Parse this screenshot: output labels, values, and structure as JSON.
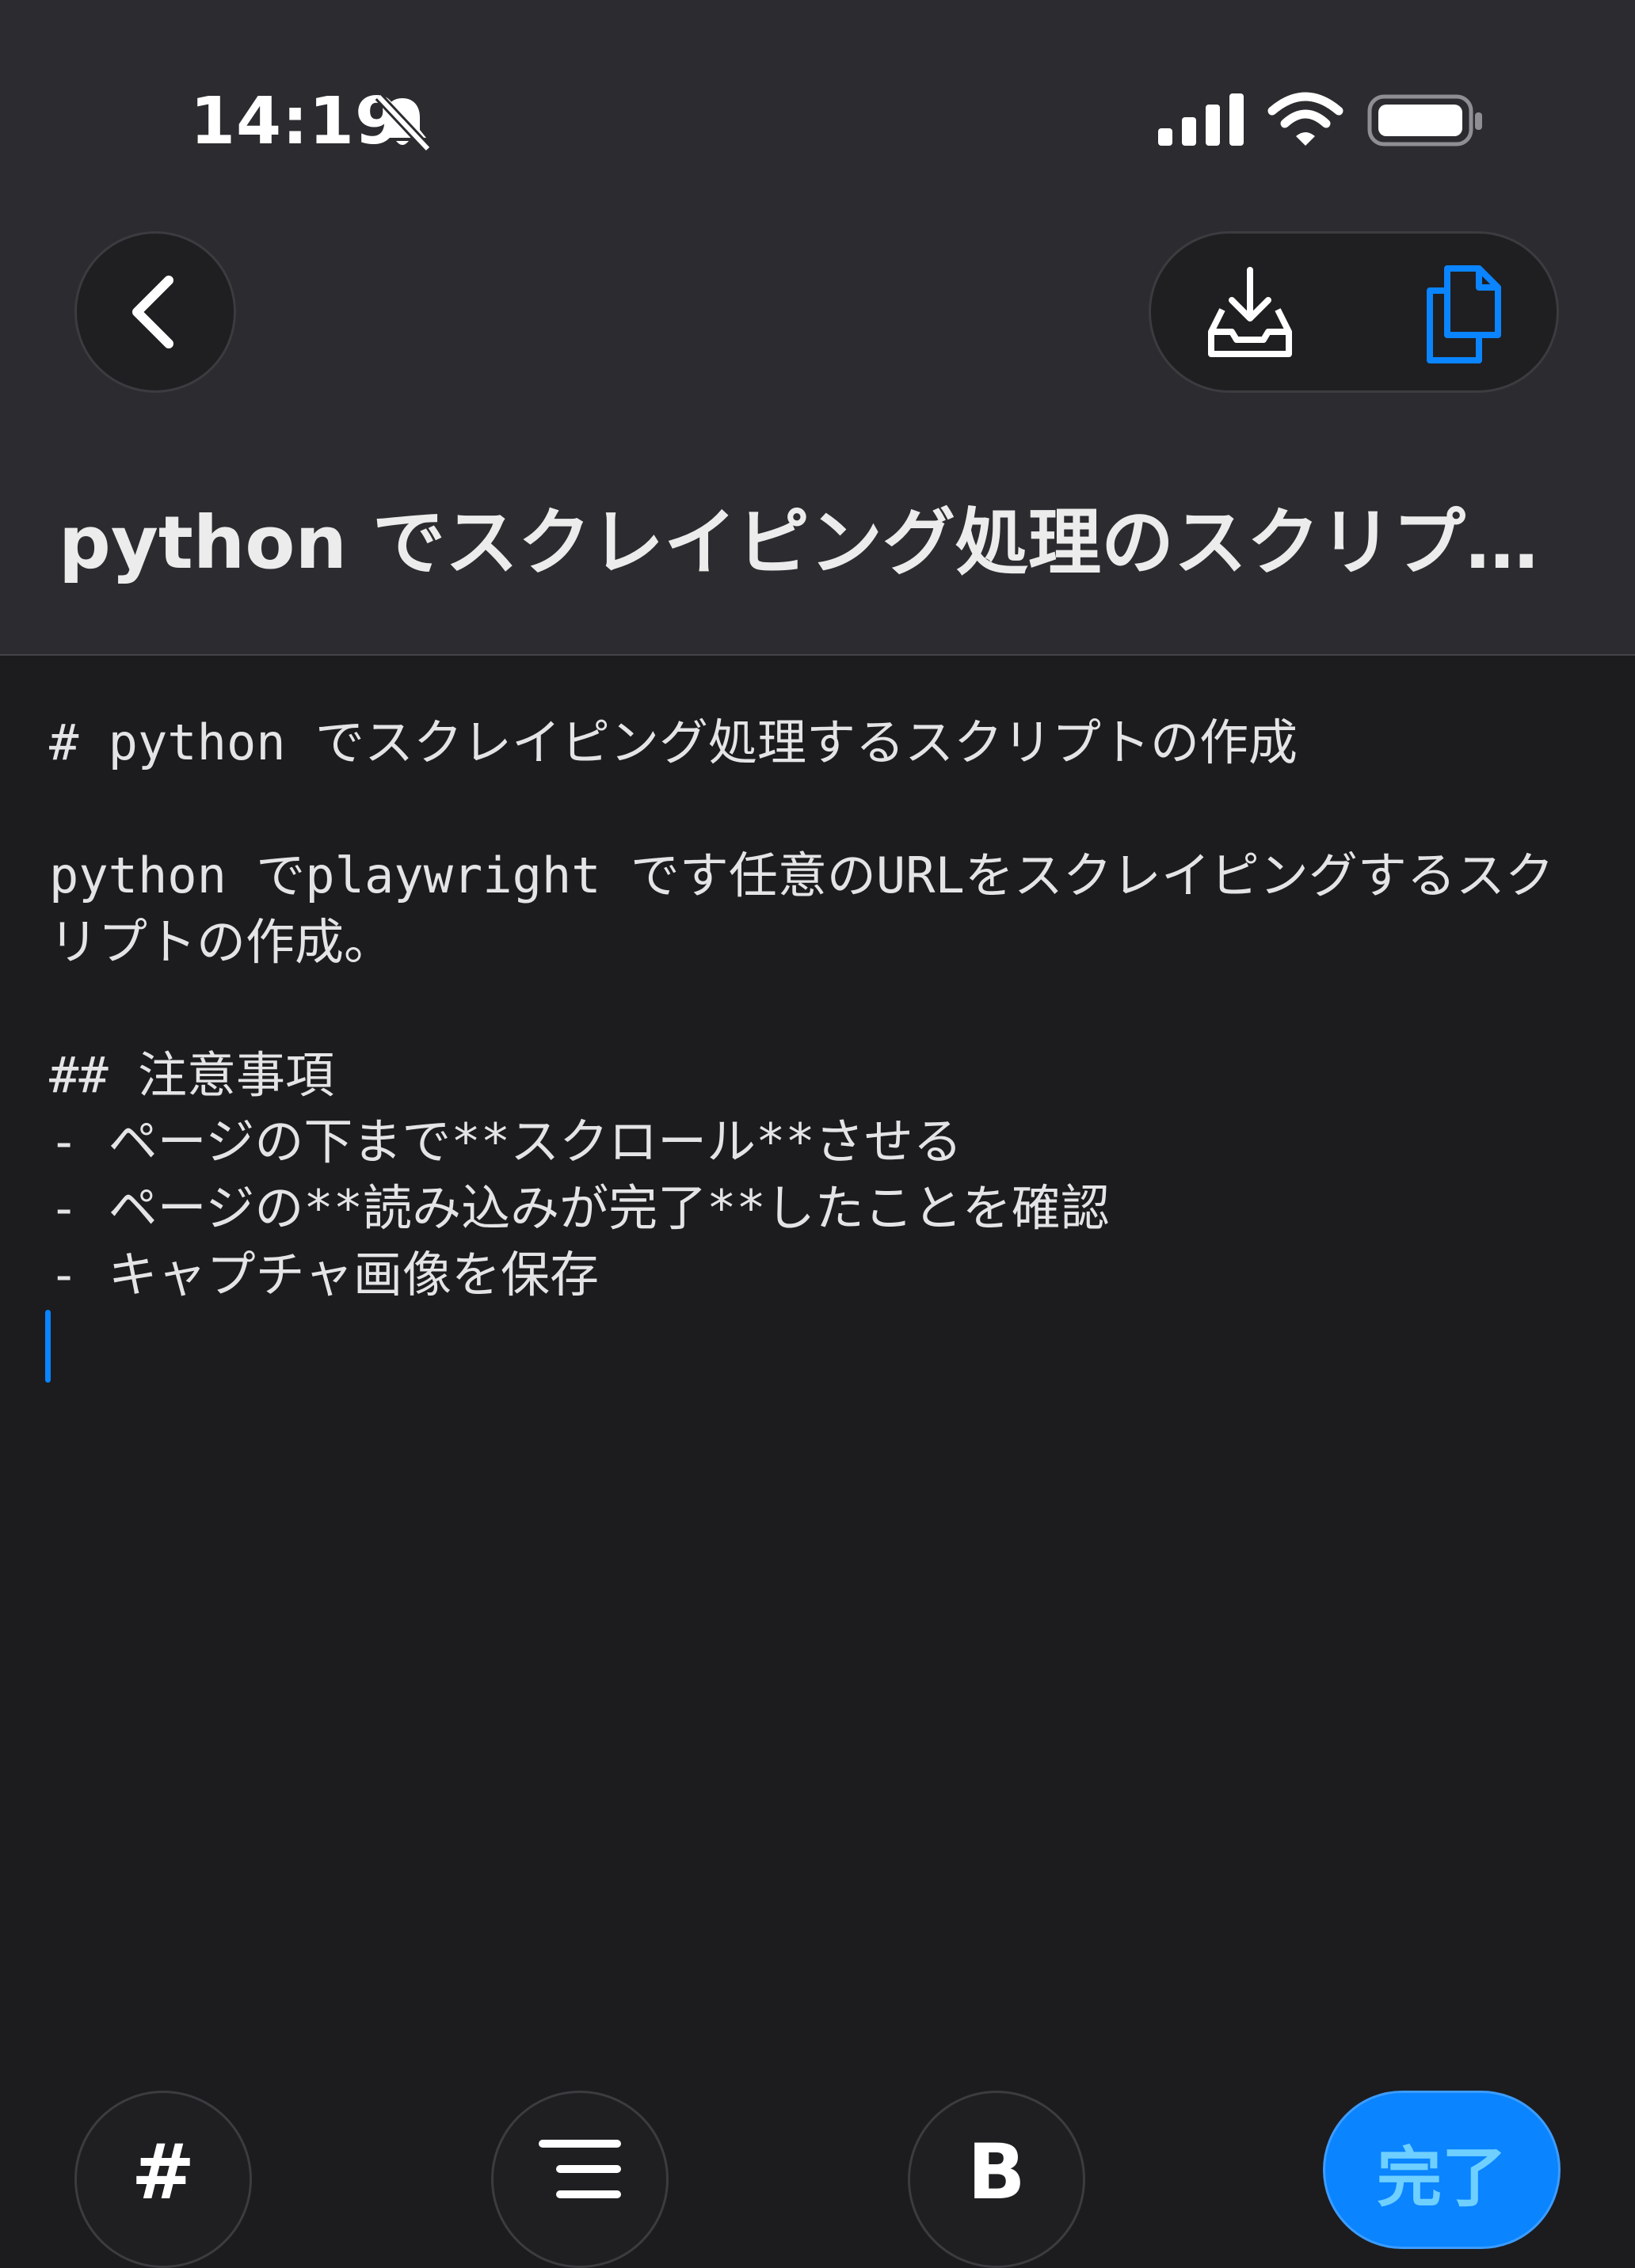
{
  "status_bar": {
    "time": "14:19",
    "silent_icon": "bell-slash-icon",
    "signal_icon": "cellular-signal-icon",
    "wifi_icon": "wifi-icon",
    "battery_icon": "battery-icon"
  },
  "nav": {
    "back_icon": "chevron-left-icon",
    "import_icon": "tray-download-icon",
    "copy_icon": "copy-documents-icon",
    "accent_color": "#0a84ff"
  },
  "title": "python でスクレイピング処理のスクリプト作成",
  "editor": {
    "lines": [
      "# python でスクレイピング処理するスクリプトの作成",
      "",
      "python でplaywright です任意のURLをスクレイピングするスクリプトの作成。",
      "",
      "## 注意事項",
      "- ページの下まで**スクロール**させる",
      "- ページの**読み込みが完了**したことを確認",
      "- キャプチャ画像を保存"
    ]
  },
  "toolbar": {
    "heading_label": "#",
    "list_icon": "list-icon",
    "bold_label": "B",
    "done_label": "完了"
  }
}
